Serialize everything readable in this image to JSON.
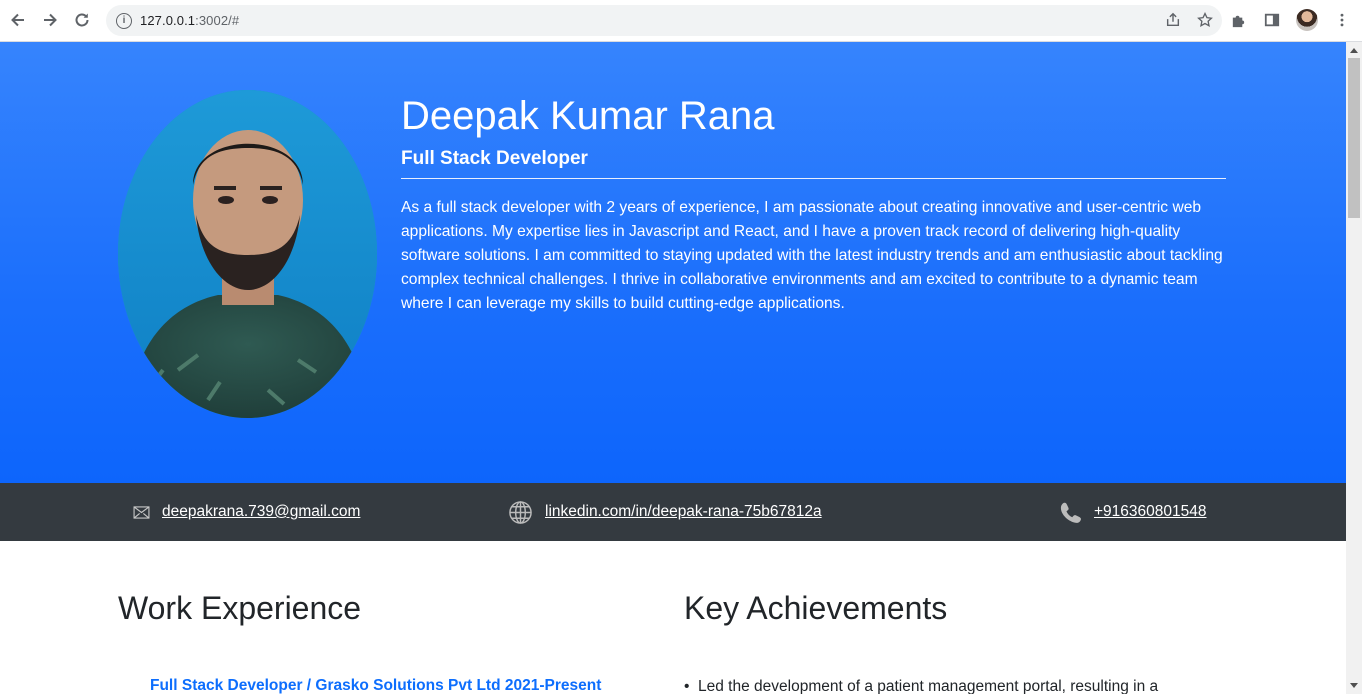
{
  "browser": {
    "url_host": "127.0.0.1",
    "url_rest": ":3002/#",
    "icons": [
      "back-arrow-icon",
      "forward-arrow-icon",
      "reload-icon",
      "site-info-icon",
      "share-icon",
      "bookmark-star-icon",
      "extensions-icon",
      "side-panel-icon",
      "profile-avatar",
      "menu-icon"
    ]
  },
  "hero": {
    "name": "Deepak Kumar Rana",
    "role": "Full Stack Developer",
    "bio": "As a full stack developer with 2 years of experience, I am passionate about creating innovative and user-centric web applications. My expertise lies in Javascript and React, and I have a proven track record of delivering high-quality software solutions. I am committed to staying updated with the latest industry trends and am enthusiastic about tackling complex technical challenges. I thrive in collaborative environments and am excited to contribute to a dynamic team where I can leverage my skills to build cutting-edge applications.",
    "colors": {
      "gradient_top": "#3684fd",
      "gradient_bottom": "#0d65fc"
    }
  },
  "contact": {
    "email": "deepakrana.739@gmail.com",
    "linkedin": "linkedin.com/in/deepak-rana-75b67812a",
    "phone": "+916360801548",
    "background": "#343a40"
  },
  "sections": {
    "work_title": "Work Experience",
    "achievements_title": "Key Achievements",
    "first_job": "Full Stack Developer / Grasko Solutions Pvt Ltd 2021-Present",
    "first_achievement": "Led the development of a patient management portal, resulting in a"
  }
}
